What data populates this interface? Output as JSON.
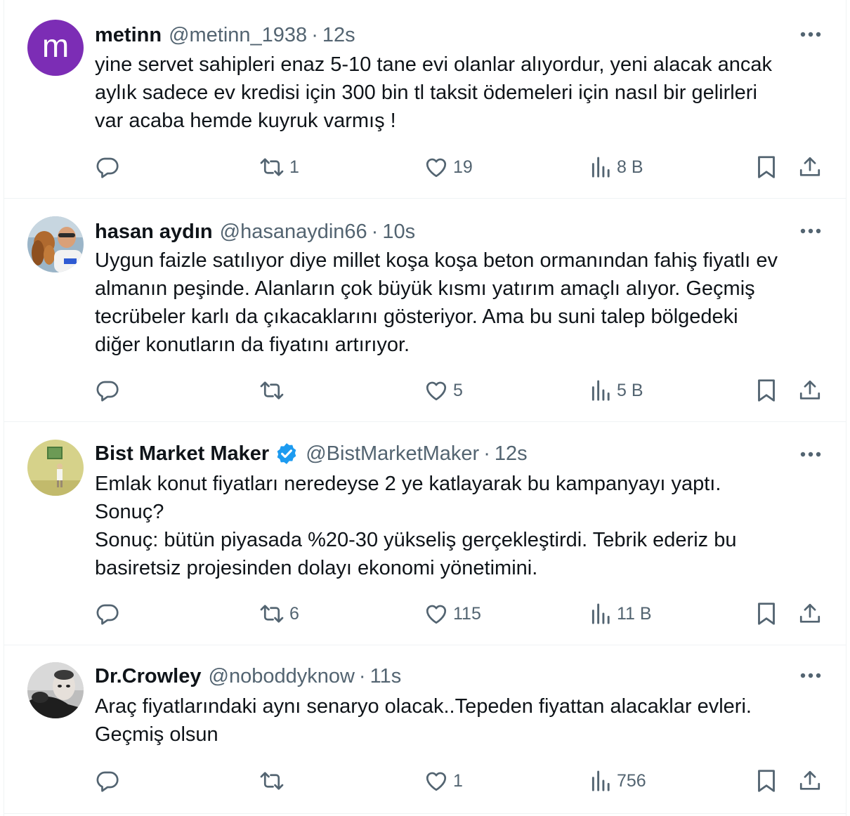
{
  "tweets": [
    {
      "avatar_letter": "m",
      "name": "metinn",
      "handle": "@metinn_1938",
      "separator": "·",
      "time": "12s",
      "verified": false,
      "lines": [
        "yine servet sahipleri enaz 5-10 tane evi olanlar alıyordur, yeni alacak ancak",
        "aylık sadece ev kredisi için 300 bin tl taksit ödemeleri için nasıl bir gelirleri",
        "var acaba hemde kuyruk varmış !"
      ],
      "replies": "",
      "retweets": "1",
      "likes": "19",
      "views": "8 B"
    },
    {
      "name": "hasan aydın",
      "handle": "@hasanaydin66",
      "separator": "·",
      "time": "10s",
      "verified": false,
      "lines": [
        "Uygun faizle satılıyor diye millet koşa koşa beton ormanından fahiş fiyatlı ev",
        "almanın peşinde. Alanların çok büyük kısmı yatırım amaçlı alıyor. Geçmiş",
        "tecrübeler karlı da çıkacaklarını gösteriyor. Ama bu suni talep bölgedeki",
        "diğer konutların da fiyatını artırıyor."
      ],
      "replies": "",
      "retweets": "",
      "likes": "5",
      "views": "5 B"
    },
    {
      "name": "Bist Market Maker",
      "handle": "@BistMarketMaker",
      "separator": "·",
      "time": "12s",
      "verified": true,
      "lines": [
        "Emlak konut fiyatları neredeyse 2 ye katlayarak bu kampanyayı yaptı.",
        "Sonuç?",
        "Sonuç: bütün piyasada %20-30 yükseliş gerçekleştirdi. Tebrik ederiz bu",
        "basiretsiz projesinden dolayı ekonomi yönetimini."
      ],
      "replies": "",
      "retweets": "6",
      "likes": "115",
      "views": "11 B"
    },
    {
      "name": "Dr.Crowley",
      "handle": "@noboddyknow",
      "separator": "·",
      "time": "11s",
      "verified": false,
      "lines": [
        "Araç fiyatlarındaki aynı senaryo olacak..Tepeden fiyattan alacaklar evleri.",
        "Geçmiş olsun"
      ],
      "replies": "",
      "retweets": "",
      "likes": "1",
      "views": "756"
    }
  ],
  "icons": {
    "reply": "reply-icon",
    "retweet": "retweet-icon",
    "like": "heart-icon",
    "views": "views-icon",
    "bookmark": "bookmark-icon",
    "share": "share-icon",
    "more": "more-icon",
    "verified": "verified-badge-icon"
  },
  "colors": {
    "avatar_m": "#7c2db5",
    "verified": "#1d9bf0",
    "secondary_text": "#536471"
  }
}
